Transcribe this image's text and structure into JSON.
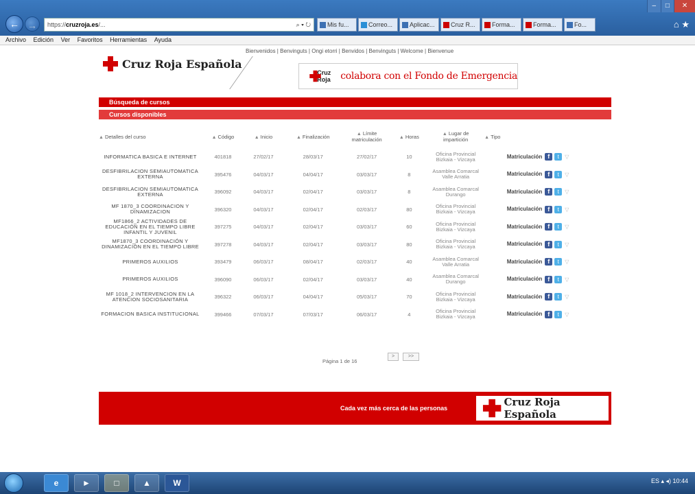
{
  "browser": {
    "url_prefix": "https://",
    "url_domain": "cruzroja.es",
    "url_rest": "/...",
    "search_glyph": "⌕ ▾ ↻",
    "tabs": [
      "Mis fu...",
      "Correo...",
      "Aplicac...",
      "Cruz R...",
      "Forma...",
      "Forma...",
      "Fo..."
    ],
    "window_controls": [
      "–",
      "□",
      "✕"
    ]
  },
  "menu": [
    "Archivo",
    "Edición",
    "Ver",
    "Favoritos",
    "Herramientas",
    "Ayuda"
  ],
  "top_links": "Bienvenidos | Benvinguts | Ongi etorri | Benvidos | Benvinguts | Welcome | Bienvenue",
  "logo_text": "Cruz Roja Española",
  "banner": {
    "brand": "Cruz Roja",
    "text": "colabora con el Fondo de Emergencia"
  },
  "search_bar": "Búsqueda de cursos",
  "available_bar": "Cursos disponibles",
  "table": {
    "headers": [
      "Detalles del curso",
      "Código",
      "Inicio",
      "Finalización",
      "Límite matriculación",
      "Horas",
      "Lugar de impartición",
      "Tipo"
    ],
    "rows": [
      {
        "title": "INFORMATICA BASICA E INTERNET",
        "code": "401818",
        "start": "27/02/17",
        "end": "28/03/17",
        "limit": "27/02/17",
        "hours": "10",
        "place": "Oficina Provincial Bizkaia - Vizcaya"
      },
      {
        "title": "DESFIBRILACION SEMIAUTOMATICA EXTERNA",
        "code": "395476",
        "start": "04/03/17",
        "end": "04/04/17",
        "limit": "03/03/17",
        "hours": "8",
        "place": "Asamblea Comarcal Valle Arratia"
      },
      {
        "title": "DESFIBRILACION SEMIAUTOMATICA EXTERNA",
        "code": "396092",
        "start": "04/03/17",
        "end": "02/04/17",
        "limit": "03/03/17",
        "hours": "8",
        "place": "Asamblea Comarcal Durango"
      },
      {
        "title": "MF 1870_3 COORDINACION Y DINAMIZACION",
        "code": "396320",
        "start": "04/03/17",
        "end": "02/04/17",
        "limit": "02/03/17",
        "hours": "80",
        "place": "Oficina Provincial Bizkaia - Vizcaya"
      },
      {
        "title": "MF1866_2 ACTIVIDADES DE EDUCACIÓN EN EL TIEMPO LIBRE INFANTIL Y JUVENIL",
        "code": "397275",
        "start": "04/03/17",
        "end": "02/04/17",
        "limit": "03/03/17",
        "hours": "60",
        "place": "Oficina Provincial Bizkaia - Vizcaya"
      },
      {
        "title": "MF1870_3 COORDINACIÓN Y DINAMIZACIÓN EN EL TIEMPO LIBRE",
        "code": "397278",
        "start": "04/03/17",
        "end": "02/04/17",
        "limit": "03/03/17",
        "hours": "80",
        "place": "Oficina Provincial Bizkaia - Vizcaya"
      },
      {
        "title": "PRIMEROS AUXILIOS",
        "code": "393479",
        "start": "06/03/17",
        "end": "08/04/17",
        "limit": "02/03/17",
        "hours": "40",
        "place": "Asamblea Comarcal Valle Arratia"
      },
      {
        "title": "PRIMEROS AUXILIOS",
        "code": "396090",
        "start": "06/03/17",
        "end": "02/04/17",
        "limit": "03/03/17",
        "hours": "40",
        "place": "Asamblea Comarcal Durango"
      },
      {
        "title": "MF 1018_2 INTERVENCION EN LA ATENCION SOCIOSANITARIA",
        "code": "396322",
        "start": "06/03/17",
        "end": "04/04/17",
        "limit": "05/03/17",
        "hours": "70",
        "place": "Oficina Provincial Bizkaia - Vizcaya"
      },
      {
        "title": "FORMACION BASICA INSTITUCIONAL",
        "code": "399466",
        "start": "07/03/17",
        "end": "07/03/17",
        "limit": "06/03/17",
        "hours": "4",
        "place": "Oficina Provincial Bizkaia - Vizcaya"
      }
    ],
    "type_label": "Matriculación",
    "facebook_glyph": "f",
    "twitter_glyph": "t",
    "extra_glyph": "▽"
  },
  "pager": {
    "text": "Página 1 de 16",
    "btn_next": ">",
    "btn_last": ">>"
  },
  "footer": {
    "text": "Cada vez más cerca de las personas",
    "logo_text": "Cruz Roja Española"
  },
  "taskbar": {
    "word_glyph": "W",
    "tray_text": "ES ▴ ◂)  10:44"
  }
}
